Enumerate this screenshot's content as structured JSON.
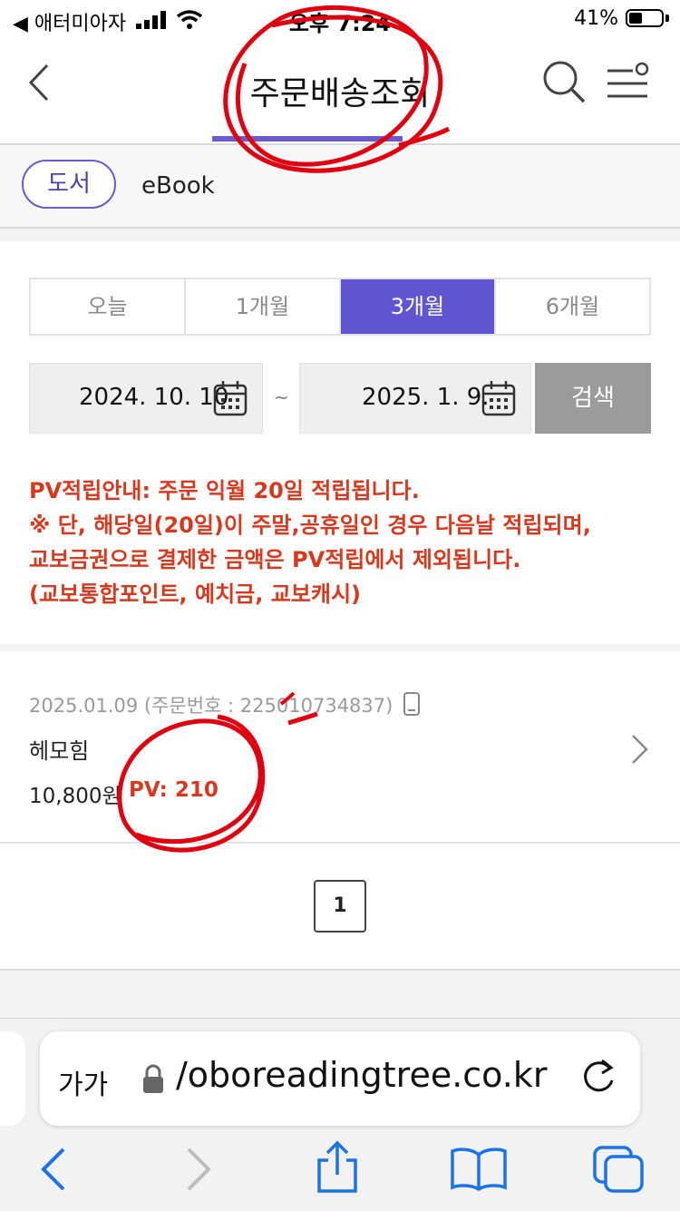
{
  "status_bar": {
    "carrier": "◀ 애터미아자",
    "time": "오후 7:24",
    "battery": "41%"
  },
  "header": {
    "title": "주문배송조회",
    "back_icon": "chevron-left-icon",
    "search_icon": "search-icon",
    "menu_icon": "menu-icon"
  },
  "subtabs": {
    "items": [
      "도서",
      "eBook"
    ],
    "active": "도서"
  },
  "period_filter": {
    "options": [
      "오늘",
      "1개월",
      "3개월",
      "6개월"
    ],
    "selected": "3개월"
  },
  "date_range": {
    "start": "2024. 10. 10",
    "separator": "~",
    "end": "2025. 1. 9.",
    "search_label": "검색"
  },
  "notice": {
    "lines": [
      "PV적립안내: 주문 익월 20일 적립됩니다.",
      "※ 단, 해당일(20일)이 주말,공휴일인 경우 다음날 적립되며,",
      "교보금권으로 결제한 금액은 PV적립에서 제외됩니다.",
      "(교보통합포인트, 예치금, 교보캐시)"
    ]
  },
  "orders": [
    {
      "meta": "2025.01.09 (주문번호 : 225010734837)",
      "name": "헤모힘",
      "price": "10,800원",
      "pv": "PV: 210"
    }
  ],
  "pagination": {
    "current": "1"
  },
  "browser": {
    "aa_label": "가가",
    "url": "/oboreadingtree.co.kr"
  },
  "colors": {
    "accent": "#6055d0",
    "notice_red": "#d9381e",
    "ios_blue": "#1a73e8"
  }
}
